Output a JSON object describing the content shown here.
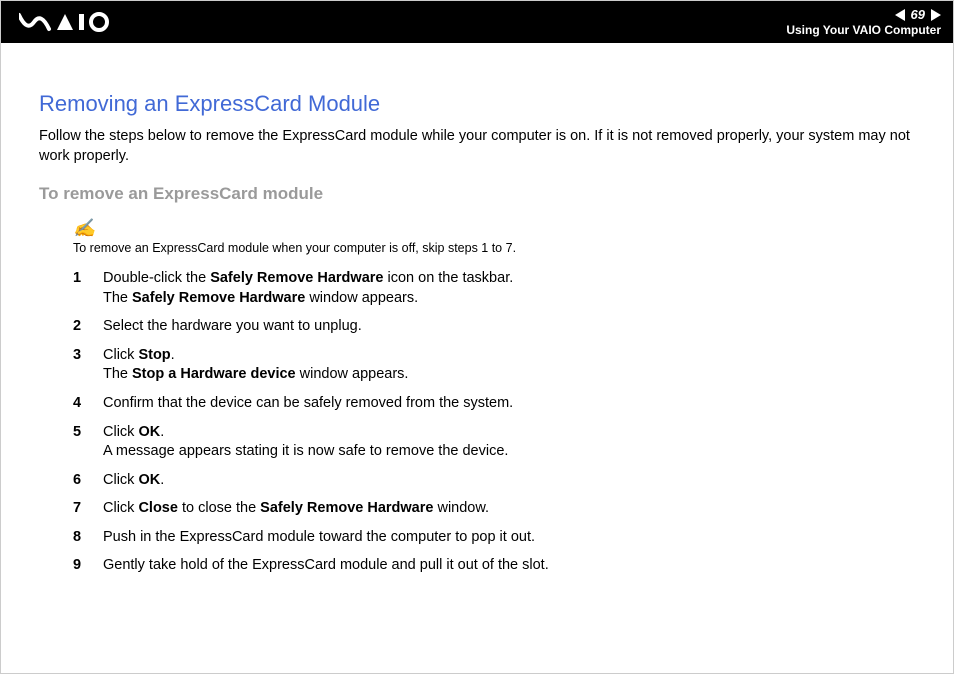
{
  "header": {
    "page_number": "69",
    "section": "Using Your VAIO Computer"
  },
  "title": "Removing an ExpressCard Module",
  "intro": "Follow the steps below to remove the ExpressCard module while your computer is on. If it is not removed properly, your system may not work properly.",
  "subtitle": "To remove an ExpressCard module",
  "note_icon": "✍",
  "note_text": "To remove an ExpressCard module when your computer is off, skip steps 1 to 7.",
  "steps": [
    {
      "n": "1",
      "pre": "Double-click the ",
      "b1": "Safely Remove Hardware",
      "mid": " icon on the taskbar.",
      "br": true,
      "post_pre": "The ",
      "post_b": "Safely Remove Hardware",
      "post_end": " window appears."
    },
    {
      "n": "2",
      "pre": "Select the hardware you want to unplug."
    },
    {
      "n": "3",
      "pre": "Click ",
      "b1": "Stop",
      "mid": ".",
      "br": true,
      "post_pre": "The ",
      "post_b": "Stop a Hardware device",
      "post_end": " window appears."
    },
    {
      "n": "4",
      "pre": "Confirm that the device can be safely removed from the system."
    },
    {
      "n": "5",
      "pre": "Click ",
      "b1": "OK",
      "mid": ".",
      "br": true,
      "post_pre": "A message appears stating it is now safe to remove the device."
    },
    {
      "n": "6",
      "pre": "Click ",
      "b1": "OK",
      "mid": "."
    },
    {
      "n": "7",
      "pre": "Click ",
      "b1": "Close",
      "mid": " to close the ",
      "b2": "Safely Remove Hardware",
      "end": " window."
    },
    {
      "n": "8",
      "pre": "Push in the ExpressCard module toward the computer to pop it out."
    },
    {
      "n": "9",
      "pre": "Gently take hold of the ExpressCard module and pull it out of the slot."
    }
  ]
}
